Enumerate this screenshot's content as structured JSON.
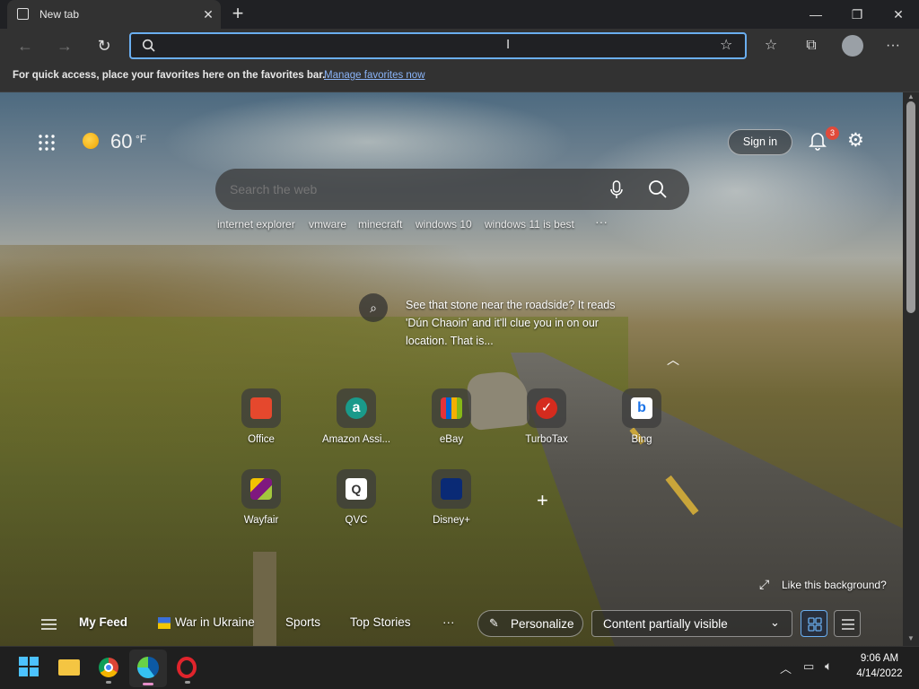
{
  "browser": {
    "tab_title": "New tab",
    "address_value": "",
    "favorites_message": "For quick access, place your favorites here on the favorites bar.",
    "favorites_link": "Manage favorites now"
  },
  "newtab": {
    "weather_temp": "60",
    "weather_unit": "°F",
    "sign_in": "Sign in",
    "notification_count": "3",
    "search_placeholder": "Search the web",
    "suggestions": [
      "internet explorer",
      "vmware",
      "minecraft",
      "windows 10",
      "windows 11 is best"
    ],
    "more_suggestions": "···",
    "background_caption": "See that stone near the roadside? It reads 'Dún Chaoin' and it'll clue you in on our location. That is...",
    "like_background": "Like this background?",
    "shortcuts": [
      {
        "label": "Office",
        "color": "#e5482d"
      },
      {
        "label": "Amazon Assi...",
        "color": "#1a9a8a"
      },
      {
        "label": "eBay",
        "color": "#e53238"
      },
      {
        "label": "TurboTax",
        "color": "#d52b1e"
      },
      {
        "label": "Bing",
        "color": "#ffffff"
      },
      {
        "label": "Wayfair",
        "color": "#7f187f"
      },
      {
        "label": "QVC",
        "color": "#ffffff"
      },
      {
        "label": "Disney+",
        "color": "#0a2a75"
      }
    ],
    "feed": {
      "my_feed": "My Feed",
      "war_in_ukraine": "War in Ukraine",
      "sports": "Sports",
      "top_stories": "Top Stories",
      "more": "···",
      "personalize": "Personalize",
      "content_visibility": "Content partially visible"
    }
  },
  "taskbar": {
    "time": "9:06 AM",
    "date": "4/14/2022"
  },
  "colors": {
    "accent_blue": "#6aaef0",
    "notification_badge": "#e04a3a"
  }
}
